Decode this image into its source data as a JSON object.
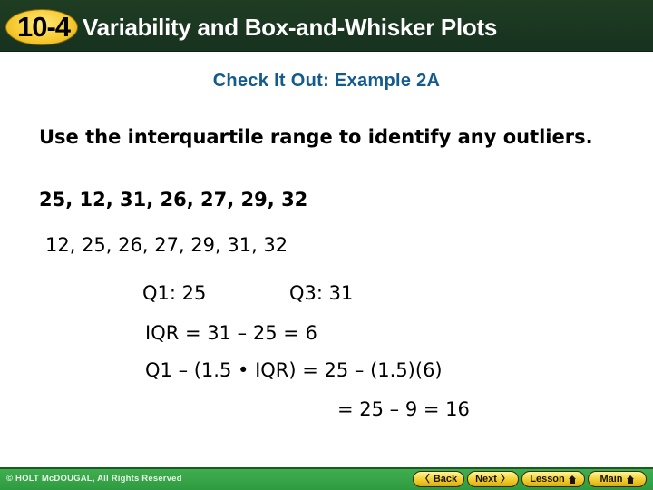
{
  "header": {
    "lesson_number": "10-4",
    "title": "Variability and Box-and-Whisker Plots",
    "colors": {
      "background": "#1b3720",
      "badge": "#f5c92e",
      "title_text": "#ffffff"
    }
  },
  "slide": {
    "subtitle": "Check It Out: Example 2A",
    "prompt": "Use the interquartile range to identify any outliers.",
    "dataset": "25, 12, 31, 26, 27, 29, 32",
    "sorted_dataset": "12, 25, 26, 27, 29, 31, 32",
    "q1": "Q1: 25",
    "q3": "Q3: 31",
    "iqr_line": "IQR = 31 – 25 = 6",
    "lower_fence_line": "Q1 – (1.5 • IQR) = 25 – (1.5)(6)",
    "lower_fence_result": "= 25 – 9 = 16",
    "colors": {
      "subtitle": "#135b8c",
      "body_text": "#000000"
    }
  },
  "footer": {
    "copyright": "© HOLT McDOUGAL, All Rights Reserved",
    "nav": {
      "back": {
        "label": "Back",
        "icon": "chevron-left-icon",
        "glyph": "〈"
      },
      "next": {
        "label": "Next",
        "icon": "chevron-right-icon",
        "glyph": "〉"
      },
      "lesson": {
        "label": "Lesson",
        "icon": "home-icon"
      },
      "main": {
        "label": "Main",
        "icon": "home-icon"
      }
    },
    "colors": {
      "background": "#36a548",
      "button": "#f2cf2c"
    }
  }
}
